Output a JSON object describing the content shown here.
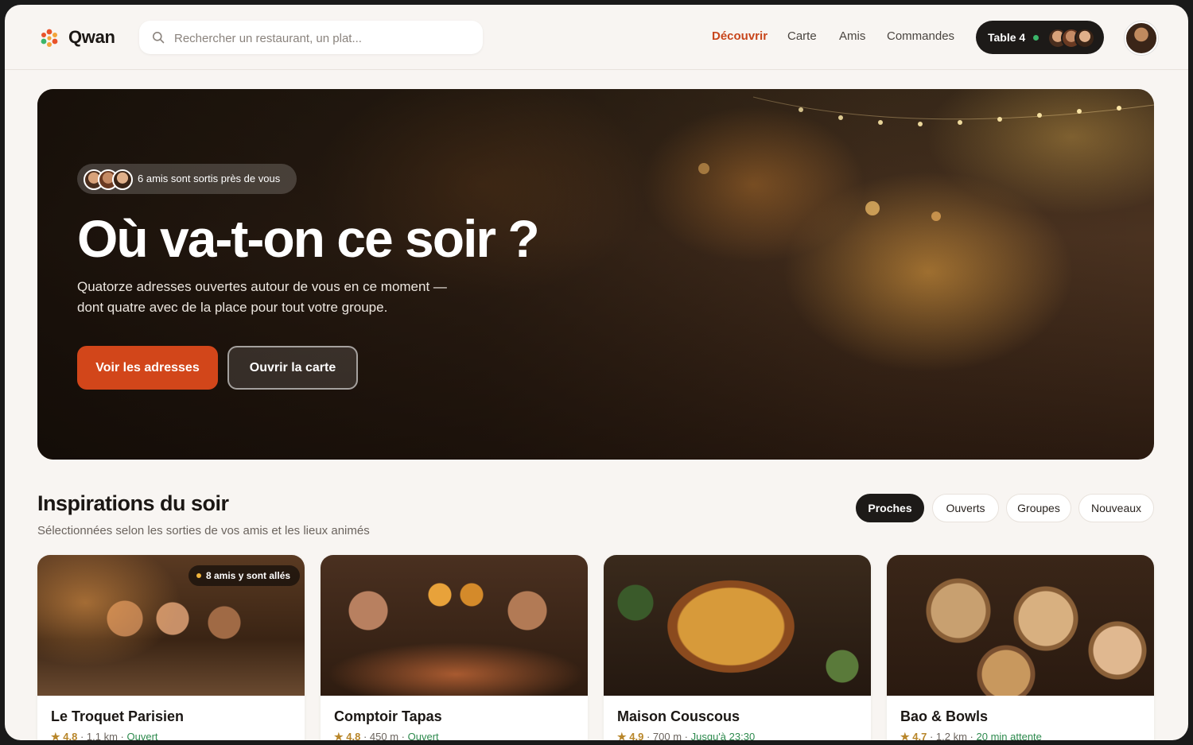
{
  "app": {
    "name": "Qwan"
  },
  "search": {
    "placeholder": "Rechercher un restaurant, un plat..."
  },
  "nav": {
    "items": [
      {
        "label": "Découvrir",
        "active": true
      },
      {
        "label": "Carte"
      },
      {
        "label": "Amis"
      },
      {
        "label": "Commandes"
      }
    ]
  },
  "table": {
    "label": "Table 4",
    "status_color": "#3bb56a"
  },
  "hero": {
    "friends_text": "6 amis sont sortis près de vous",
    "title": "Où va-t-on ce soir ?",
    "subtitle": "Quatorze adresses ouvertes autour de vous en ce moment — dont quatre avec de la place pour tout votre groupe.",
    "primary_cta": "Voir les adresses",
    "secondary_cta": "Ouvrir la carte"
  },
  "section": {
    "title": "Inspirations du soir",
    "subtitle": "Sélectionnées selon les sorties de vos amis et les lieux animés",
    "filters": [
      {
        "label": "Proches",
        "active": true
      },
      {
        "label": "Ouverts"
      },
      {
        "label": "Groupes"
      },
      {
        "label": "Nouveaux"
      }
    ]
  },
  "cards": [
    {
      "name": "Le Troquet Parisien",
      "badge": "8 amis y sont allés",
      "rating": "4.8",
      "distance": "1.1 km",
      "status": "Ouvert"
    },
    {
      "name": "Comptoir Tapas",
      "rating": "4.8",
      "distance": "450 m",
      "status": "Ouvert"
    },
    {
      "name": "Maison Couscous",
      "rating": "4.9",
      "distance": "700 m",
      "status": "Jusqu'à 23:30"
    },
    {
      "name": "Bao & Bowls",
      "rating": "4.7",
      "distance": "1.2 km",
      "status": "20 min attente"
    }
  ],
  "colors": {
    "accent": "#d2461a",
    "dark": "#1d1a18",
    "open": "#2e8a4e",
    "star": "#b8862a",
    "background": "#f8f5f2"
  }
}
